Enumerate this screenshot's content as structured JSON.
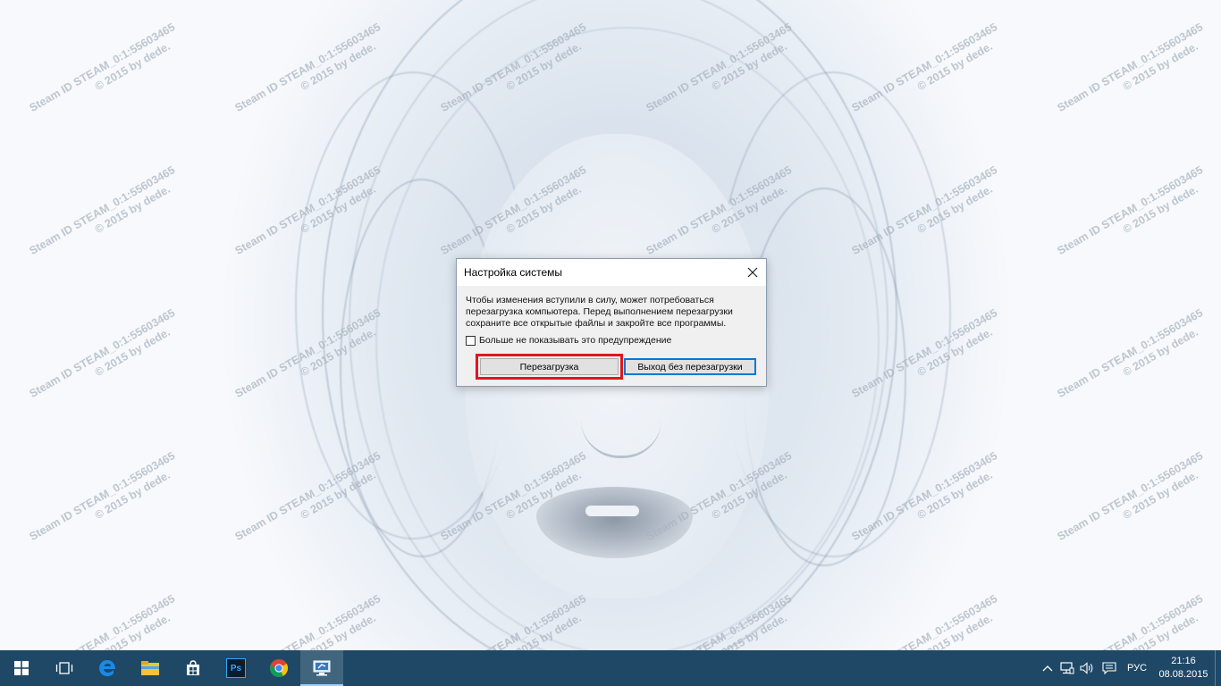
{
  "desktop": {
    "watermark_line1": "Steam ID  STEAM_0:1:55603465",
    "watermark_line2": "© 2015 by dede."
  },
  "dialog": {
    "title": "Настройка системы",
    "close_icon": "close-icon",
    "message": "Чтобы изменения вступили в силу, может потребоваться перезагрузка компьютера. Перед выполнением перезагрузки сохраните все открытые файлы и закройте все программы.",
    "checkbox_label": "Больше не показывать это предупреждение",
    "checkbox_checked": false,
    "restart_button": "Перезагрузка",
    "exit_button": "Выход без перезагрузки",
    "highlight_color": "#e0161e"
  },
  "taskbar": {
    "background": "#1e4866",
    "apps": [
      {
        "icon": "windows-start-icon"
      },
      {
        "icon": "task-view-icon"
      },
      {
        "icon": "edge-icon"
      },
      {
        "icon": "file-explorer-icon"
      },
      {
        "icon": "store-icon"
      },
      {
        "icon": "photoshop-icon",
        "label": "Ps"
      },
      {
        "icon": "chrome-icon"
      },
      {
        "icon": "system-config-icon"
      }
    ],
    "tray": {
      "language": "РУС",
      "time": "21:16",
      "date": "08.08.2015"
    }
  }
}
